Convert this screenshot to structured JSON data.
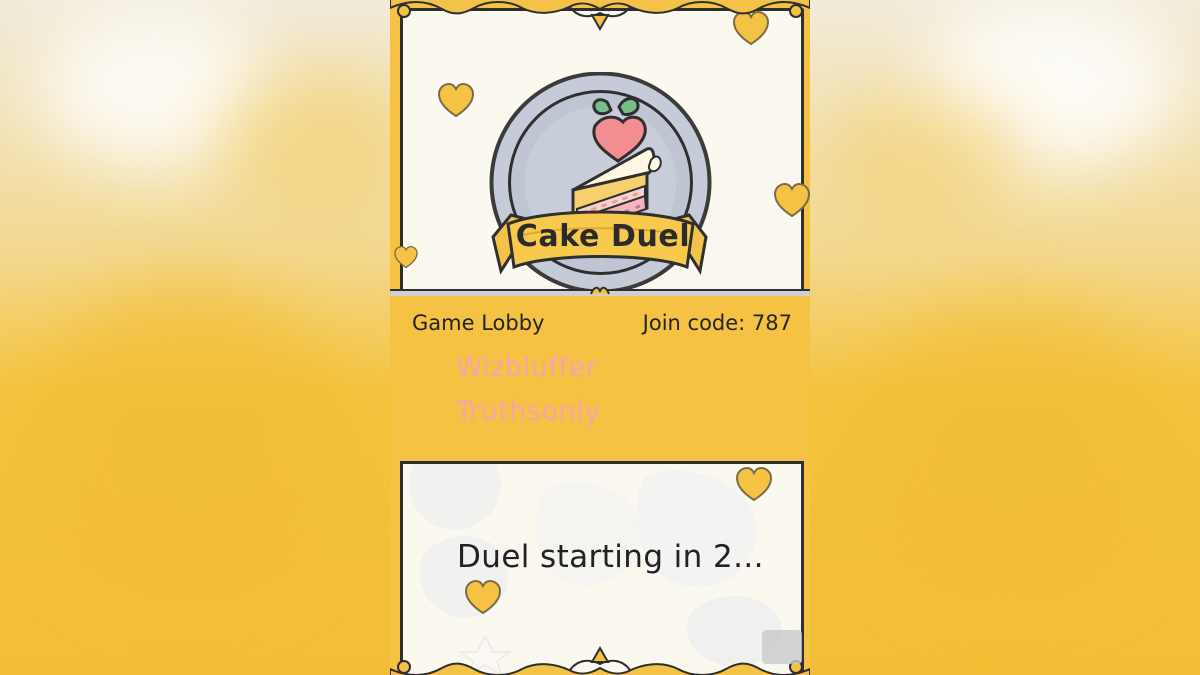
{
  "game": {
    "title": "Cake Duel"
  },
  "lobby": {
    "heading": "Game Lobby",
    "join_code": "Join code: 787",
    "players": [
      {
        "name": "Wizbluffer"
      },
      {
        "name": "Truthsonly"
      }
    ]
  },
  "status": {
    "countdown": "Duel starting in 2..."
  },
  "icons": {
    "logo": "cake-slice-icon",
    "decorations": "heart-icon",
    "border": "ornament-icon"
  },
  "colors": {
    "frame_yellow": "#f5c243",
    "player_pink": "#f7a4ad",
    "panel_cream": "#fbf8f0"
  }
}
